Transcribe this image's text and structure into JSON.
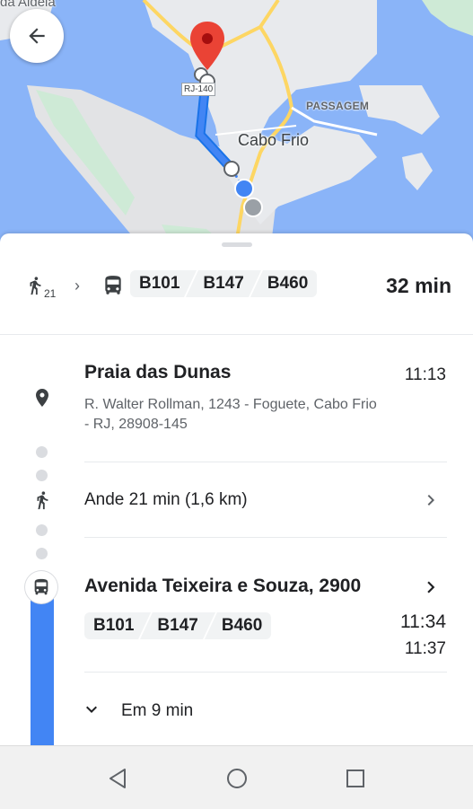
{
  "map": {
    "labels": {
      "aldeia": "da Aldeia",
      "passagem": "PASSAGEM",
      "cabo_frio": "Cabo Frio",
      "road": "RJ-140"
    }
  },
  "summary": {
    "walk_minutes": "21",
    "bus_lines": [
      "B101",
      "B147",
      "B460"
    ],
    "duration": "32 min"
  },
  "steps": {
    "origin": {
      "name": "Praia das Dunas",
      "time": "11:13",
      "address": "R. Walter Rollman, 1243 - Foguete, Cabo Frio - RJ, 28908-145"
    },
    "walk": {
      "text": "Ande 21 min (1,6 km)"
    },
    "bus_stop": {
      "name": "Avenida Teixeira e Souza, 2900",
      "lines": [
        "B101",
        "B147",
        "B460"
      ],
      "time_primary": "11:34",
      "time_secondary": "11:37",
      "expand_text": "Em 9 min"
    }
  },
  "colors": {
    "water": "#8ab4f8",
    "land": "#e8eaed",
    "route": "#4285f4",
    "pin": "#ea4335"
  }
}
